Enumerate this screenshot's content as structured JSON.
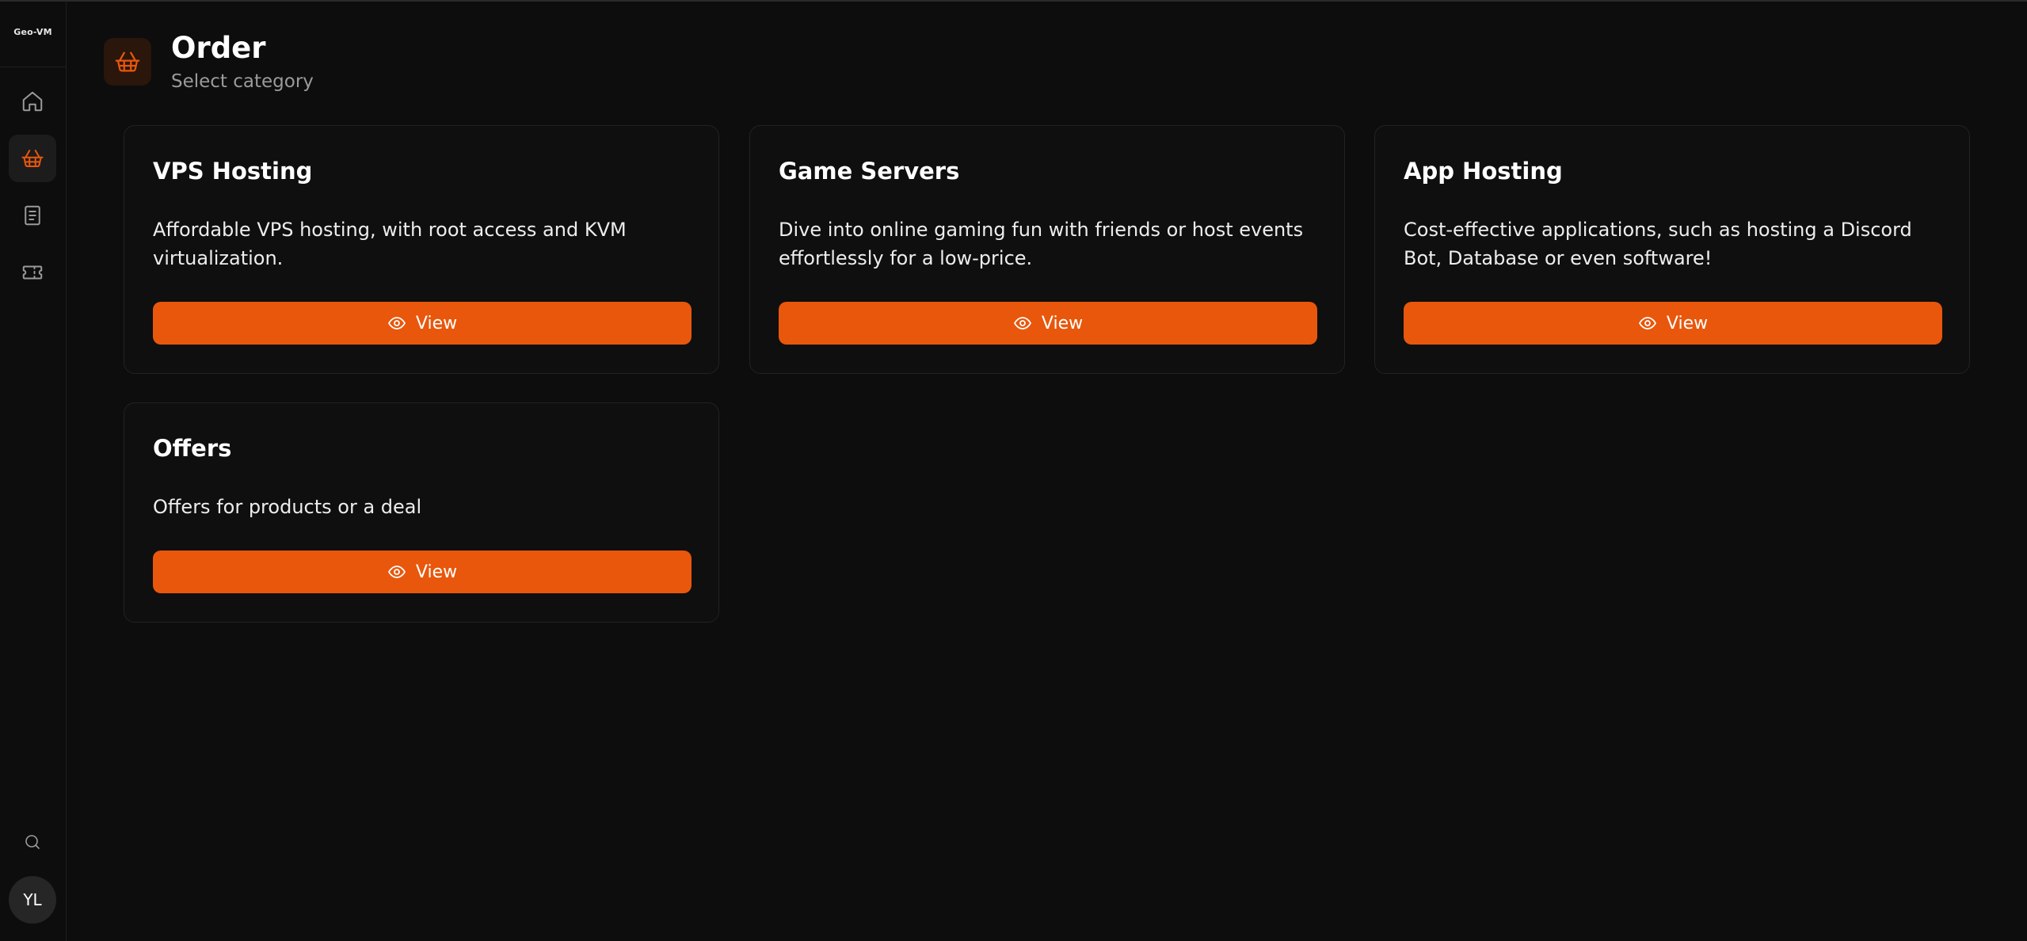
{
  "sidebar": {
    "logo_text": "Geo-VM",
    "items": [
      {
        "name": "home",
        "icon": "home-icon",
        "active": false
      },
      {
        "name": "order",
        "icon": "basket-icon",
        "active": true
      },
      {
        "name": "invoices",
        "icon": "document-icon",
        "active": false
      },
      {
        "name": "tickets",
        "icon": "ticket-icon",
        "active": false
      }
    ],
    "search_icon": "search-icon",
    "avatar_initials": "YL"
  },
  "header": {
    "icon": "basket-icon",
    "title": "Order",
    "subtitle": "Select category"
  },
  "categories": [
    {
      "title": "VPS Hosting",
      "description": "Affordable VPS hosting, with root access and KVM virtualization.",
      "button_label": "View"
    },
    {
      "title": "Game Servers",
      "description": "Dive into online gaming fun with friends or host events effortlessly for a low-price.",
      "button_label": "View"
    },
    {
      "title": "App Hosting",
      "description": "Cost-effective applications, such as hosting a Discord Bot, Database or even software!",
      "button_label": "View"
    },
    {
      "title": "Offers",
      "description": "Offers for products or a deal",
      "button_label": "View"
    }
  ],
  "colors": {
    "accent": "#e8570c",
    "background": "#0d0d0d",
    "card_border": "#222222"
  }
}
